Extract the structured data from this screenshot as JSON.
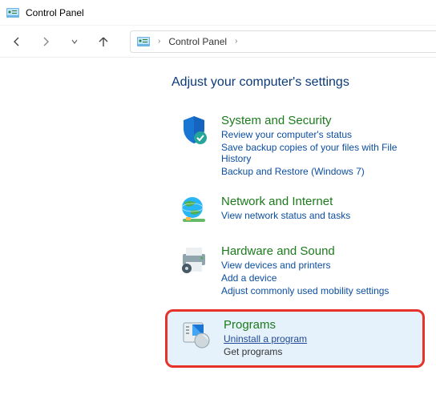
{
  "titlebar": {
    "title": "Control Panel"
  },
  "breadcrumb": {
    "label": "Control Panel"
  },
  "heading": "Adjust your computer's settings",
  "categories": [
    {
      "title": "System and Security",
      "links": [
        "Review your computer's status",
        "Save backup copies of your files with File History",
        "Backup and Restore (Windows 7)"
      ]
    },
    {
      "title": "Network and Internet",
      "links": [
        "View network status and tasks"
      ]
    },
    {
      "title": "Hardware and Sound",
      "links": [
        "View devices and printers",
        "Add a device",
        "Adjust commonly used mobility settings"
      ]
    },
    {
      "title": "Programs",
      "links": [
        "Uninstall a program",
        "Get programs"
      ]
    }
  ]
}
